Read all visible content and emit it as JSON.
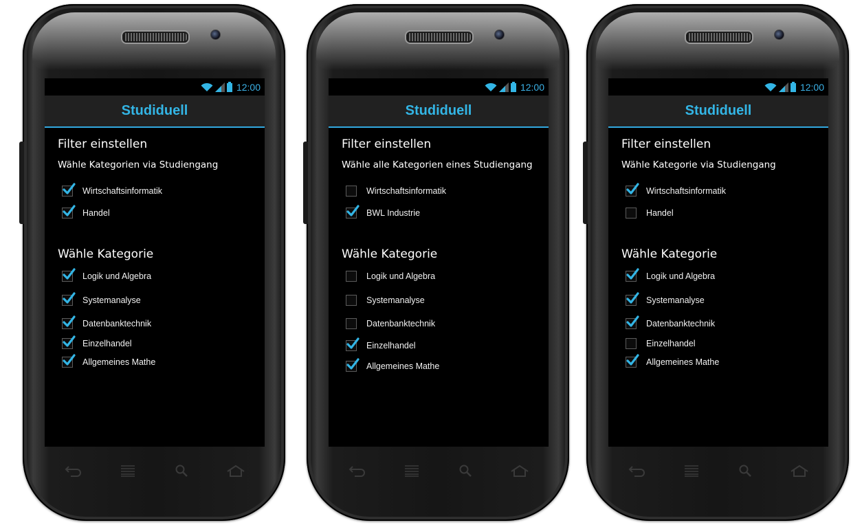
{
  "phones": [
    {
      "status_time": "12:00",
      "app_title": "Studiduell",
      "filter_title": "Filter einstellen",
      "study_subtitle": "Wähle Kategorien via Studiengang",
      "study_options": [
        {
          "label": "Wirtschaftsinformatik",
          "checked": true
        },
        {
          "label": "Handel",
          "checked": true
        }
      ],
      "category_title": "Wähle Kategorie",
      "category_options": [
        {
          "label": "Logik und Algebra",
          "checked": true
        },
        {
          "label": "Systemanalyse",
          "checked": true
        },
        {
          "label": "Datenbanktechnik",
          "checked": true
        },
        {
          "label": "Einzelhandel",
          "checked": true
        },
        {
          "label": "Allgemeines Mathe",
          "checked": true
        }
      ]
    },
    {
      "status_time": "12:00",
      "app_title": "Studiduell",
      "filter_title": "Filter einstellen",
      "study_subtitle": "Wähle alle Kategorien eines Studiengang",
      "study_options": [
        {
          "label": "Wirtschaftsinformatik",
          "checked": false
        },
        {
          "label": "BWL Industrie",
          "checked": true
        }
      ],
      "category_title": "Wähle Kategorie",
      "category_options": [
        {
          "label": "Logik und Algebra",
          "checked": false
        },
        {
          "label": "Systemanalyse",
          "checked": false
        },
        {
          "label": "Datenbanktechnik",
          "checked": false
        },
        {
          "label": "Einzelhandel",
          "checked": true
        },
        {
          "label": "Allgemeines Mathe",
          "checked": true
        }
      ]
    },
    {
      "status_time": "12:00",
      "app_title": "Studiduell",
      "filter_title": "Filter einstellen",
      "study_subtitle": "Wähle Kategorie via Studiengang",
      "study_options": [
        {
          "label": "Wirtschaftsinformatik",
          "checked": true
        },
        {
          "label": "Handel",
          "checked": false
        }
      ],
      "category_title": "Wähle Kategorie",
      "category_options": [
        {
          "label": "Logik und Algebra",
          "checked": true
        },
        {
          "label": "Systemanalyse",
          "checked": true
        },
        {
          "label": "Datenbanktechnik",
          "checked": true
        },
        {
          "label": "Einzelhandel",
          "checked": false
        },
        {
          "label": "Allgemeines Mathe",
          "checked": true
        }
      ]
    }
  ],
  "icons": {
    "status": [
      "wifi-icon",
      "signal-icon",
      "battery-icon"
    ],
    "nav": [
      "back-icon",
      "menu-icon",
      "search-icon",
      "home-icon"
    ]
  },
  "colors": {
    "accent": "#33b5e5",
    "title_bar": "#212121",
    "screen_bg": "#000000"
  }
}
